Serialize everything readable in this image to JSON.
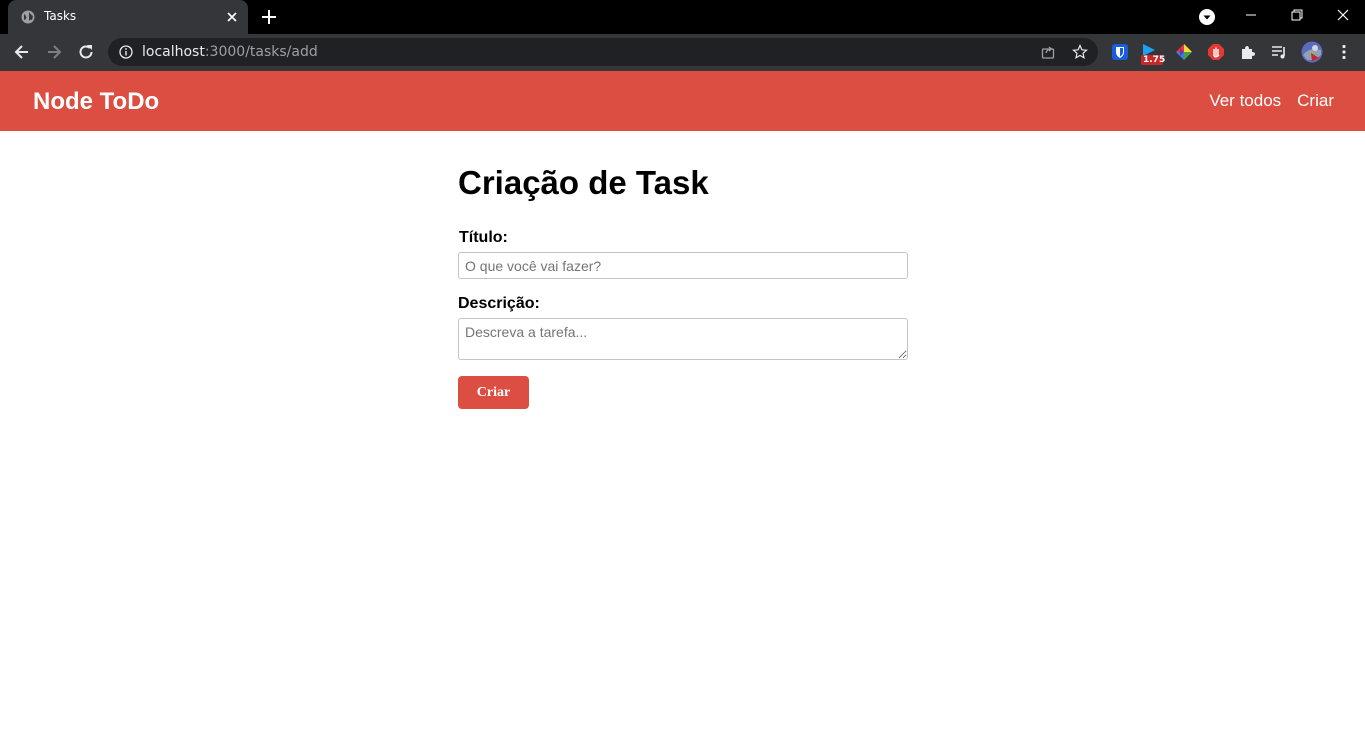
{
  "browser": {
    "tab_title": "Tasks",
    "url_host": "localhost",
    "url_rest": ":3000/tasks/add",
    "extension_badge": "1.75"
  },
  "app": {
    "brand": "Node ToDo",
    "nav": [
      {
        "label": "Ver todos"
      },
      {
        "label": "Criar"
      }
    ],
    "accent_color": "#dc4e41"
  },
  "form": {
    "title": "Criação de Task",
    "title_label": "Título:",
    "title_placeholder": "O que você vai fazer?",
    "description_label": "Descrição:",
    "description_placeholder": "Descreva a tarefa...",
    "submit_label": "Criar"
  }
}
